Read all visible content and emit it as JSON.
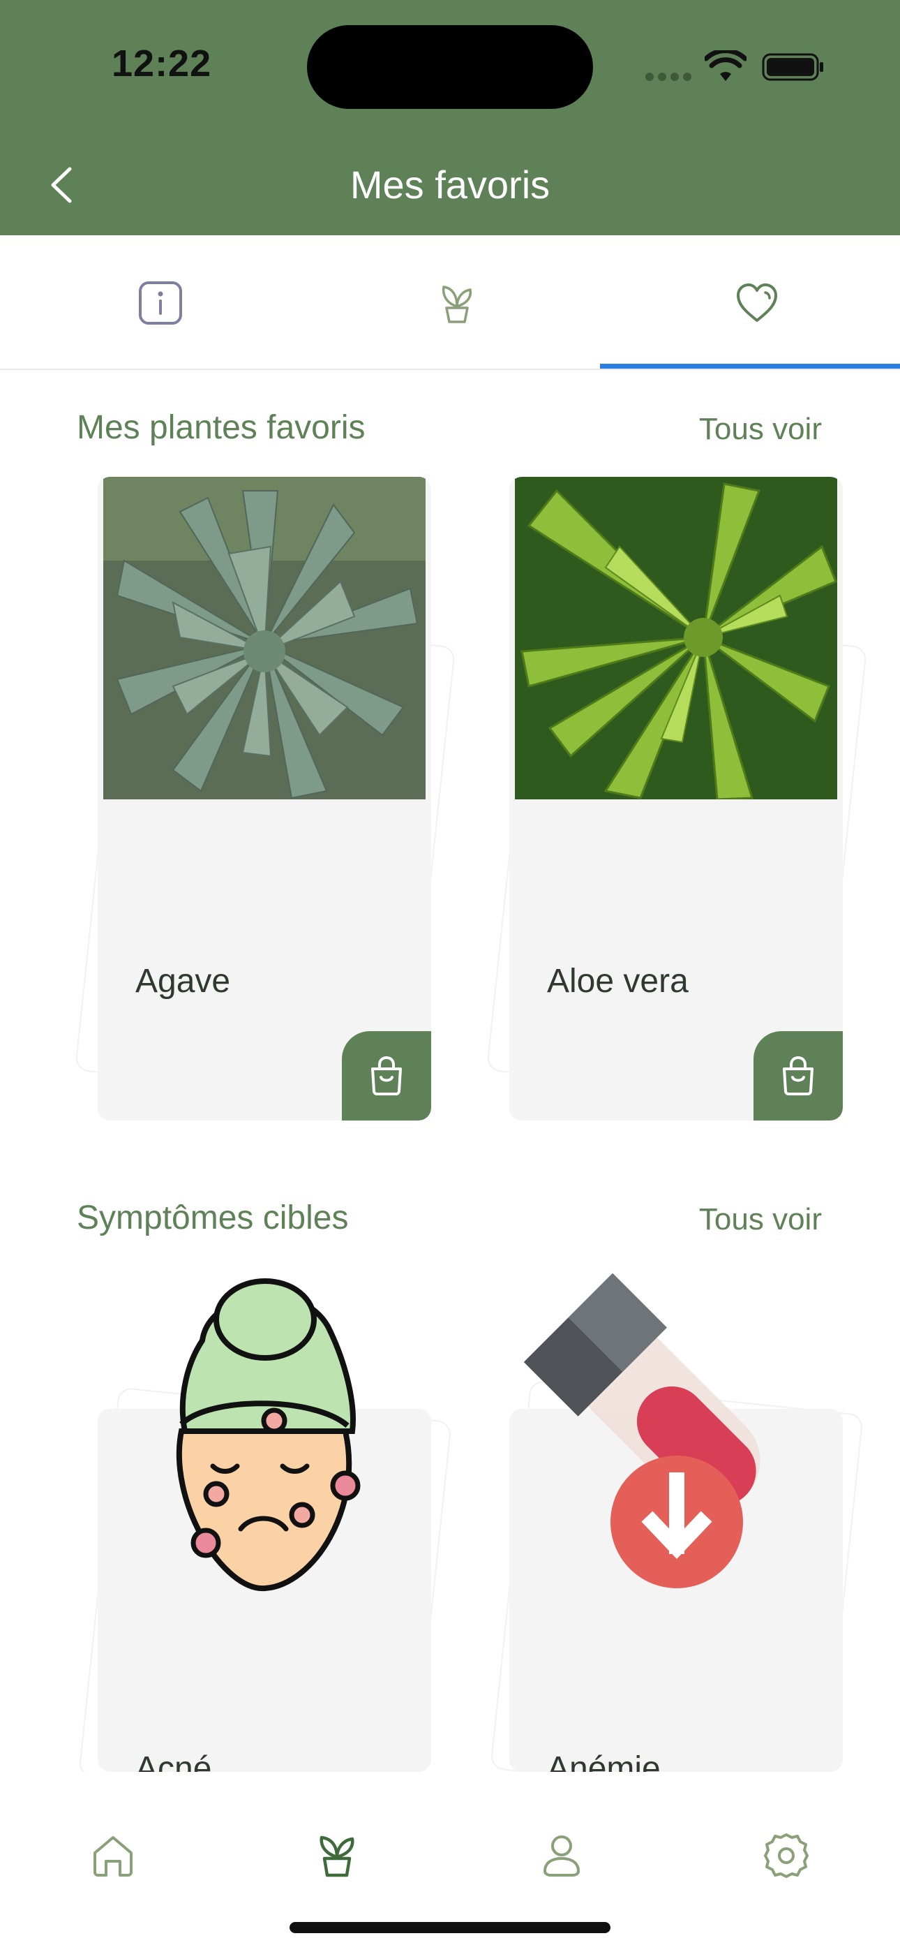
{
  "status_bar": {
    "time": "12:22"
  },
  "header": {
    "title": "Mes favoris"
  },
  "tabs": [
    {
      "icon": "info-icon"
    },
    {
      "icon": "plant-sprout-icon"
    },
    {
      "icon": "heart-icon",
      "active": true
    }
  ],
  "favorites_section": {
    "title": "Mes plantes favoris",
    "see_all": "Tous voir",
    "items": [
      {
        "label": "Agave"
      },
      {
        "label": "Aloe vera"
      }
    ]
  },
  "symptoms_section": {
    "title": "Symptômes cibles",
    "see_all": "Tous voir",
    "items": [
      {
        "label": "Acné"
      },
      {
        "label": "Anémie"
      }
    ]
  },
  "bottom_nav": [
    {
      "icon": "home-icon"
    },
    {
      "icon": "plant-icon",
      "active": true
    },
    {
      "icon": "profile-icon"
    },
    {
      "icon": "settings-icon"
    }
  ],
  "colors": {
    "brand_green": "#5e8157",
    "tab_active": "#2a7de1",
    "card_bg": "#f4f4f4"
  }
}
